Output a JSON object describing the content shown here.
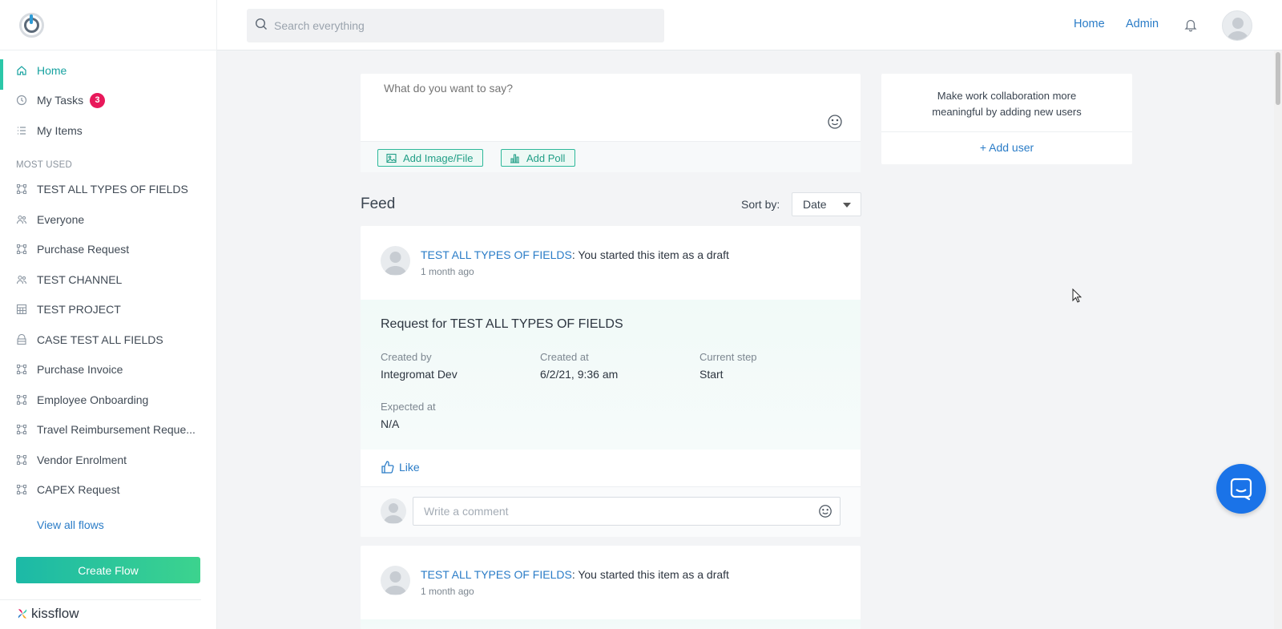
{
  "header": {
    "search_placeholder": "Search everything",
    "links": [
      "Home",
      "Admin"
    ]
  },
  "sidebar": {
    "nav": [
      {
        "label": "Home",
        "icon": "home-icon",
        "active": true
      },
      {
        "label": "My Tasks",
        "icon": "clock-icon",
        "badge": "3"
      },
      {
        "label": "My Items",
        "icon": "list-icon"
      }
    ],
    "section_title": "MOST USED",
    "flows": [
      {
        "label": "TEST ALL TYPES OF FIELDS",
        "icon": "flow-icon"
      },
      {
        "label": "Everyone",
        "icon": "people-icon"
      },
      {
        "label": "Purchase Request",
        "icon": "flow-icon"
      },
      {
        "label": "TEST CHANNEL",
        "icon": "people-icon"
      },
      {
        "label": "TEST PROJECT",
        "icon": "board-icon"
      },
      {
        "label": "CASE TEST ALL FIELDS",
        "icon": "case-icon"
      },
      {
        "label": "Purchase Invoice",
        "icon": "flow-icon"
      },
      {
        "label": "Employee Onboarding",
        "icon": "flow-icon"
      },
      {
        "label": "Travel Reimbursement Reque...",
        "icon": "flow-icon"
      },
      {
        "label": "Vendor Enrolment",
        "icon": "flow-icon"
      },
      {
        "label": "CAPEX Request",
        "icon": "flow-icon"
      }
    ],
    "view_all": "View all flows",
    "create_flow": "Create Flow",
    "brand": "kissflow"
  },
  "composer": {
    "placeholder": "What do you want to say?",
    "add_image": "Add Image/File",
    "add_poll": "Add Poll"
  },
  "feed": {
    "title": "Feed",
    "sort_label": "Sort by:",
    "sort_value": "Date",
    "posts": [
      {
        "flow": "TEST ALL TYPES OF FIELDS",
        "message": ": You started this item as a draft",
        "time": "1 month ago",
        "request_title": "Request for TEST ALL TYPES OF FIELDS",
        "created_by_label": "Created by",
        "created_by": "Integromat Dev",
        "created_at_label": "Created at",
        "created_at": "6/2/21, 9:36 am",
        "current_step_label": "Current step",
        "current_step": "Start",
        "expected_at_label": "Expected at",
        "expected_at": "N/A",
        "like": "Like",
        "comment_placeholder": "Write a comment"
      },
      {
        "flow": "TEST ALL TYPES OF FIELDS",
        "message": ": You started this item as a draft",
        "time": "1 month ago"
      }
    ]
  },
  "side": {
    "text": "Make work collaboration more meaningful by adding new users",
    "add_user": "+ Add user"
  },
  "colors": {
    "accent": "#2a7cc7",
    "teal": "#17a2a0",
    "badge": "#e8185a",
    "chat": "#1a73e8"
  }
}
